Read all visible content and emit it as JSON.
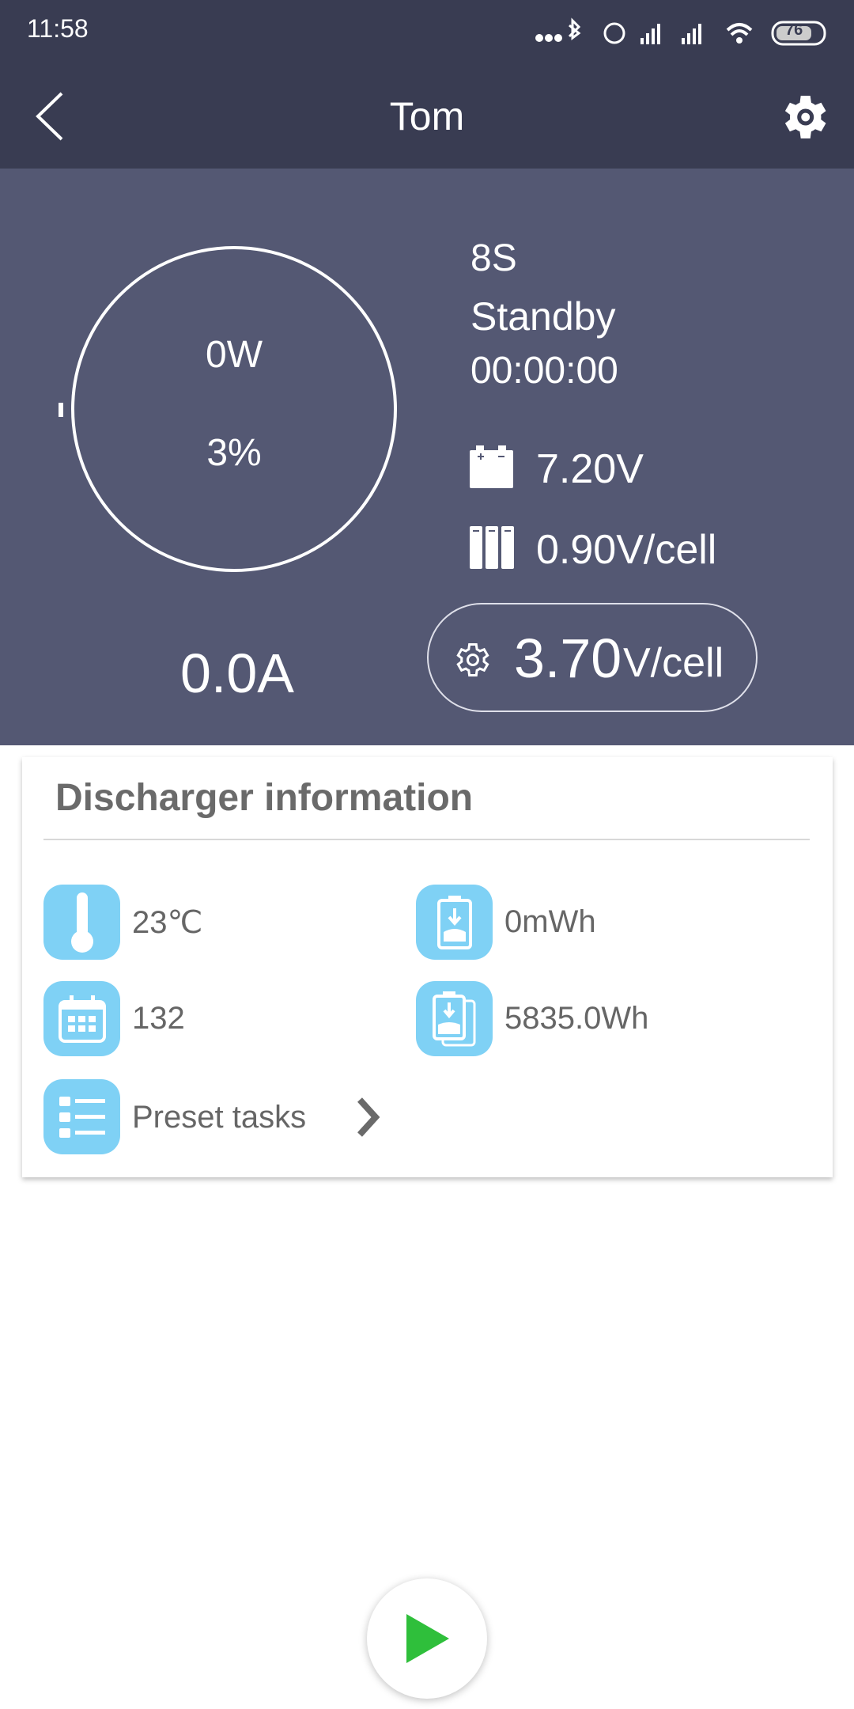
{
  "status_bar": {
    "time": "11:58",
    "battery": "76",
    "icons": [
      "more-dots-icon",
      "bluetooth-icon",
      "alarm-icon",
      "signal-icon",
      "hd-signal-icon",
      "wifi-icon",
      "battery-icon"
    ]
  },
  "header": {
    "title": "Tom",
    "back_icon": "chevron-left-icon",
    "settings_icon": "gear-icon"
  },
  "gauge": {
    "power": "0W",
    "percent": "3%",
    "percent_value": 3
  },
  "current": "0.0A",
  "info": {
    "cells": "8S",
    "state": "Standby",
    "timer": "00:00:00",
    "voltage": "7.20V",
    "cell_voltage": "0.90V/cell"
  },
  "target": {
    "value": "3.70",
    "unit": "V/cell"
  },
  "card": {
    "title": "Discharger information",
    "temperature": "23℃",
    "energy": "0mWh",
    "cycles": "132",
    "total_energy": "5835.0Wh",
    "preset_label": "Preset tasks"
  },
  "colors": {
    "header": "#393c52",
    "panel": "#545873",
    "icon_bg": "#7fd1f5",
    "play": "#2fbf3b"
  }
}
